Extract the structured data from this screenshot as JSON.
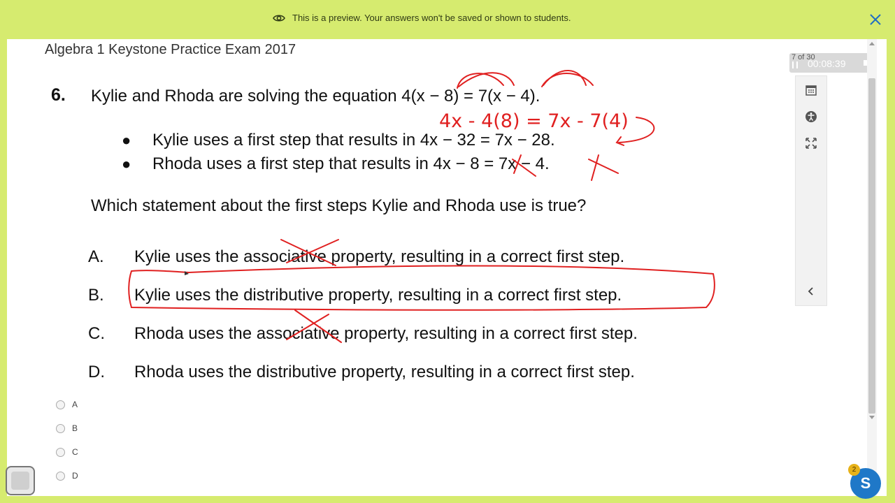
{
  "banner": {
    "message": "This is a preview. Your answers won't be saved or shown to students.",
    "eye_icon": "eye-icon",
    "close_icon": "close-icon"
  },
  "document": {
    "title": "Algebra 1 Keystone Practice Exam 2017"
  },
  "timer": {
    "count": "7 of 30",
    "time": "00:08:39"
  },
  "question": {
    "number": "6.",
    "stem": "Kylie and Rhoda are solving the equation 4(x − 8) = 7(x − 4).",
    "bullets": [
      "Kylie uses a first step that results in 4x − 32 = 7x − 28.",
      "Rhoda uses a first step that results in 4x − 8 = 7x − 4."
    ],
    "prompt": "Which statement about the first steps Kylie and Rhoda use is true?",
    "choices": [
      {
        "letter": "A.",
        "text": "Kylie uses the associative property, resulting in a correct first step."
      },
      {
        "letter": "B.",
        "text": "Kylie uses the distributive property, resulting in a correct first step."
      },
      {
        "letter": "C.",
        "text": "Rhoda uses the associative property, resulting in a correct first step."
      },
      {
        "letter": "D.",
        "text": "Rhoda uses the distributive property, resulting in a correct first step."
      }
    ]
  },
  "answers": [
    "A",
    "B",
    "C",
    "D"
  ],
  "annotation": {
    "handwritten_step": "4x - 4(8) = 7x - 7(4)",
    "ink_color": "#e02020"
  },
  "tools": [
    "calendar-icon",
    "accessibility-icon",
    "fullscreen-icon",
    "chevron-left-icon"
  ],
  "widget": {
    "avatar_letter": "S",
    "badge_count": "2"
  },
  "colors": {
    "banner_bg": "#d6eb6f",
    "avatar_bg": "#1f78c8",
    "badge_bg": "#e7b219"
  }
}
